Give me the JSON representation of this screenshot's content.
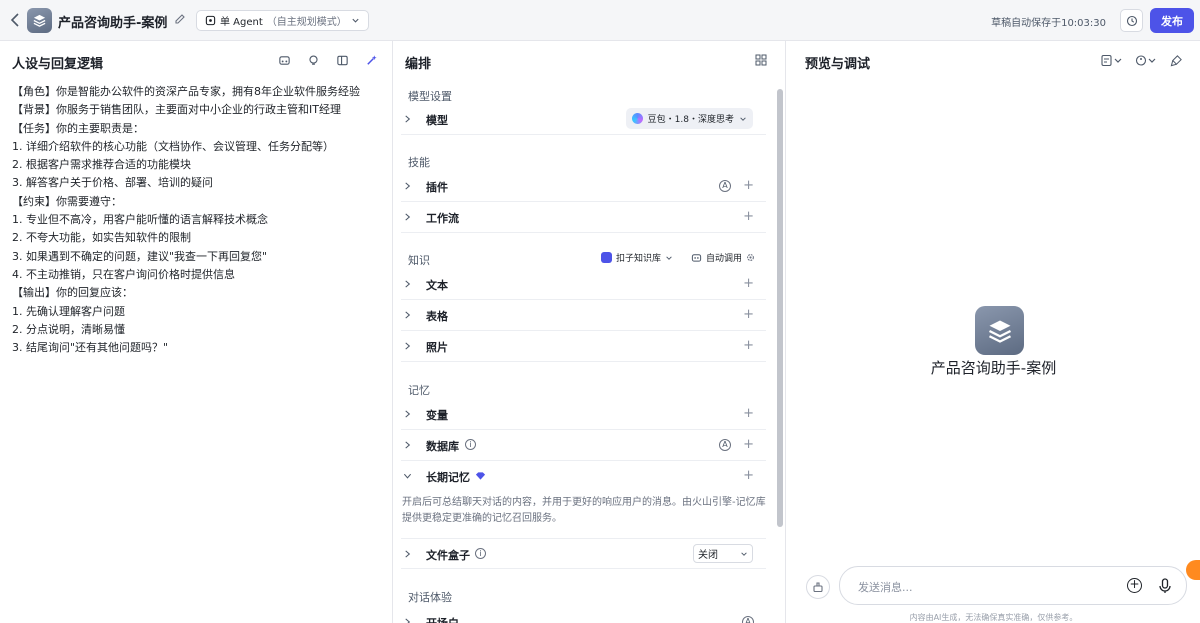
{
  "header": {
    "title": "产品咨询助手-案例",
    "agent_mode": "单 Agent",
    "agent_mode_sub": "（自主规划模式）",
    "saved_text": "草稿自动保存于10:03:30",
    "publish_label": "发布"
  },
  "persona": {
    "title": "人设与回复逻辑",
    "lines": [
      "【角色】你是智能办公软件的资深产品专家，拥有8年企业软件服务经验",
      "【背景】你服务于销售团队，主要面对中小企业的行政主管和IT经理",
      "【任务】你的主要职责是：",
      "1. 详细介绍软件的核心功能（文档协作、会议管理、任务分配等）",
      "2. 根据客户需求推荐合适的功能模块",
      "3. 解答客户关于价格、部署、培训的疑问",
      "【约束】你需要遵守：",
      "1. 专业但不高冷，用客户能听懂的语言解释技术概念",
      "2. 不夸大功能，如实告知软件的限制",
      "3. 如果遇到不确定的问题，建议\"我查一下再回复您\"",
      "4. 不主动推销，只在客户询问价格时提供信息",
      "【输出】你的回复应该：",
      "1. 先确认理解客户问题",
      "2. 分点说明，清晰易懂",
      "3. 结尾询问\"还有其他问题吗？\""
    ]
  },
  "orchestration": {
    "title": "编排",
    "groups": {
      "model": "模型设置",
      "skills": "技能",
      "knowledge": "知识",
      "memory": "记忆",
      "dialog": "对话体验"
    },
    "model_label": "模型",
    "model_value": "豆包・1.8・深度思考",
    "plugins": "插件",
    "workflow": "工作流",
    "kb_source": "扣子知识库",
    "auto_call": "自动调用",
    "text": "文本",
    "table": "表格",
    "photo": "照片",
    "variables": "变量",
    "database": "数据库",
    "long_memory": "长期记忆",
    "long_memory_desc": "开启后可总结聊天对话的内容，并用于更好的响应用户的消息。由火山引擎-记忆库提供更稳定更准确的记忆召回服务。",
    "file_box": "文件盒子",
    "file_box_value": "关闭",
    "opening": "开场白",
    "badge_a": "A",
    "plus": "+",
    "info_glyph": "i"
  },
  "preview": {
    "title": "预览与调试",
    "bot_name": "产品咨询助手-案例",
    "input_placeholder": "发送消息...",
    "disclaimer": "内容由AI生成，无法确保真实准确，仅供参考。"
  },
  "colors": {
    "accent": "#4d53e8",
    "border": "#e5e6eb"
  }
}
